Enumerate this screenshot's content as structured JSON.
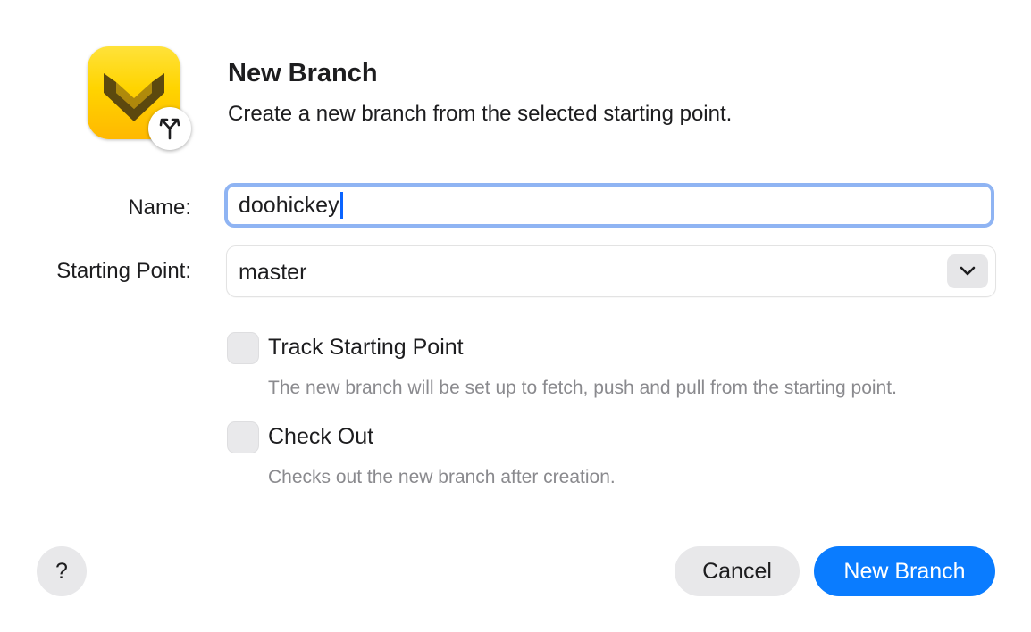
{
  "dialog": {
    "title": "New Branch",
    "subtitle": "Create a new branch from the selected starting point.",
    "icons": {
      "app": "app-logo-icon",
      "badge": "branch-fork-icon"
    }
  },
  "form": {
    "name_label": "Name:",
    "name_value": "doohickey",
    "starting_point_label": "Starting Point:",
    "starting_point_value": "master",
    "dropdown_icon": "chevron-down-icon"
  },
  "options": [
    {
      "label": "Track Starting Point",
      "description": "The new branch will be set up to fetch, push and pull from the starting point.",
      "checked": false
    },
    {
      "label": "Check Out",
      "description": "Checks out the new branch after creation.",
      "checked": false
    }
  ],
  "footer": {
    "help_label": "?",
    "cancel_label": "Cancel",
    "primary_label": "New Branch"
  },
  "colors": {
    "accent": "#0a7cff",
    "focus_ring": "#8fb4f3",
    "icon_yellow": "#ffd400"
  }
}
